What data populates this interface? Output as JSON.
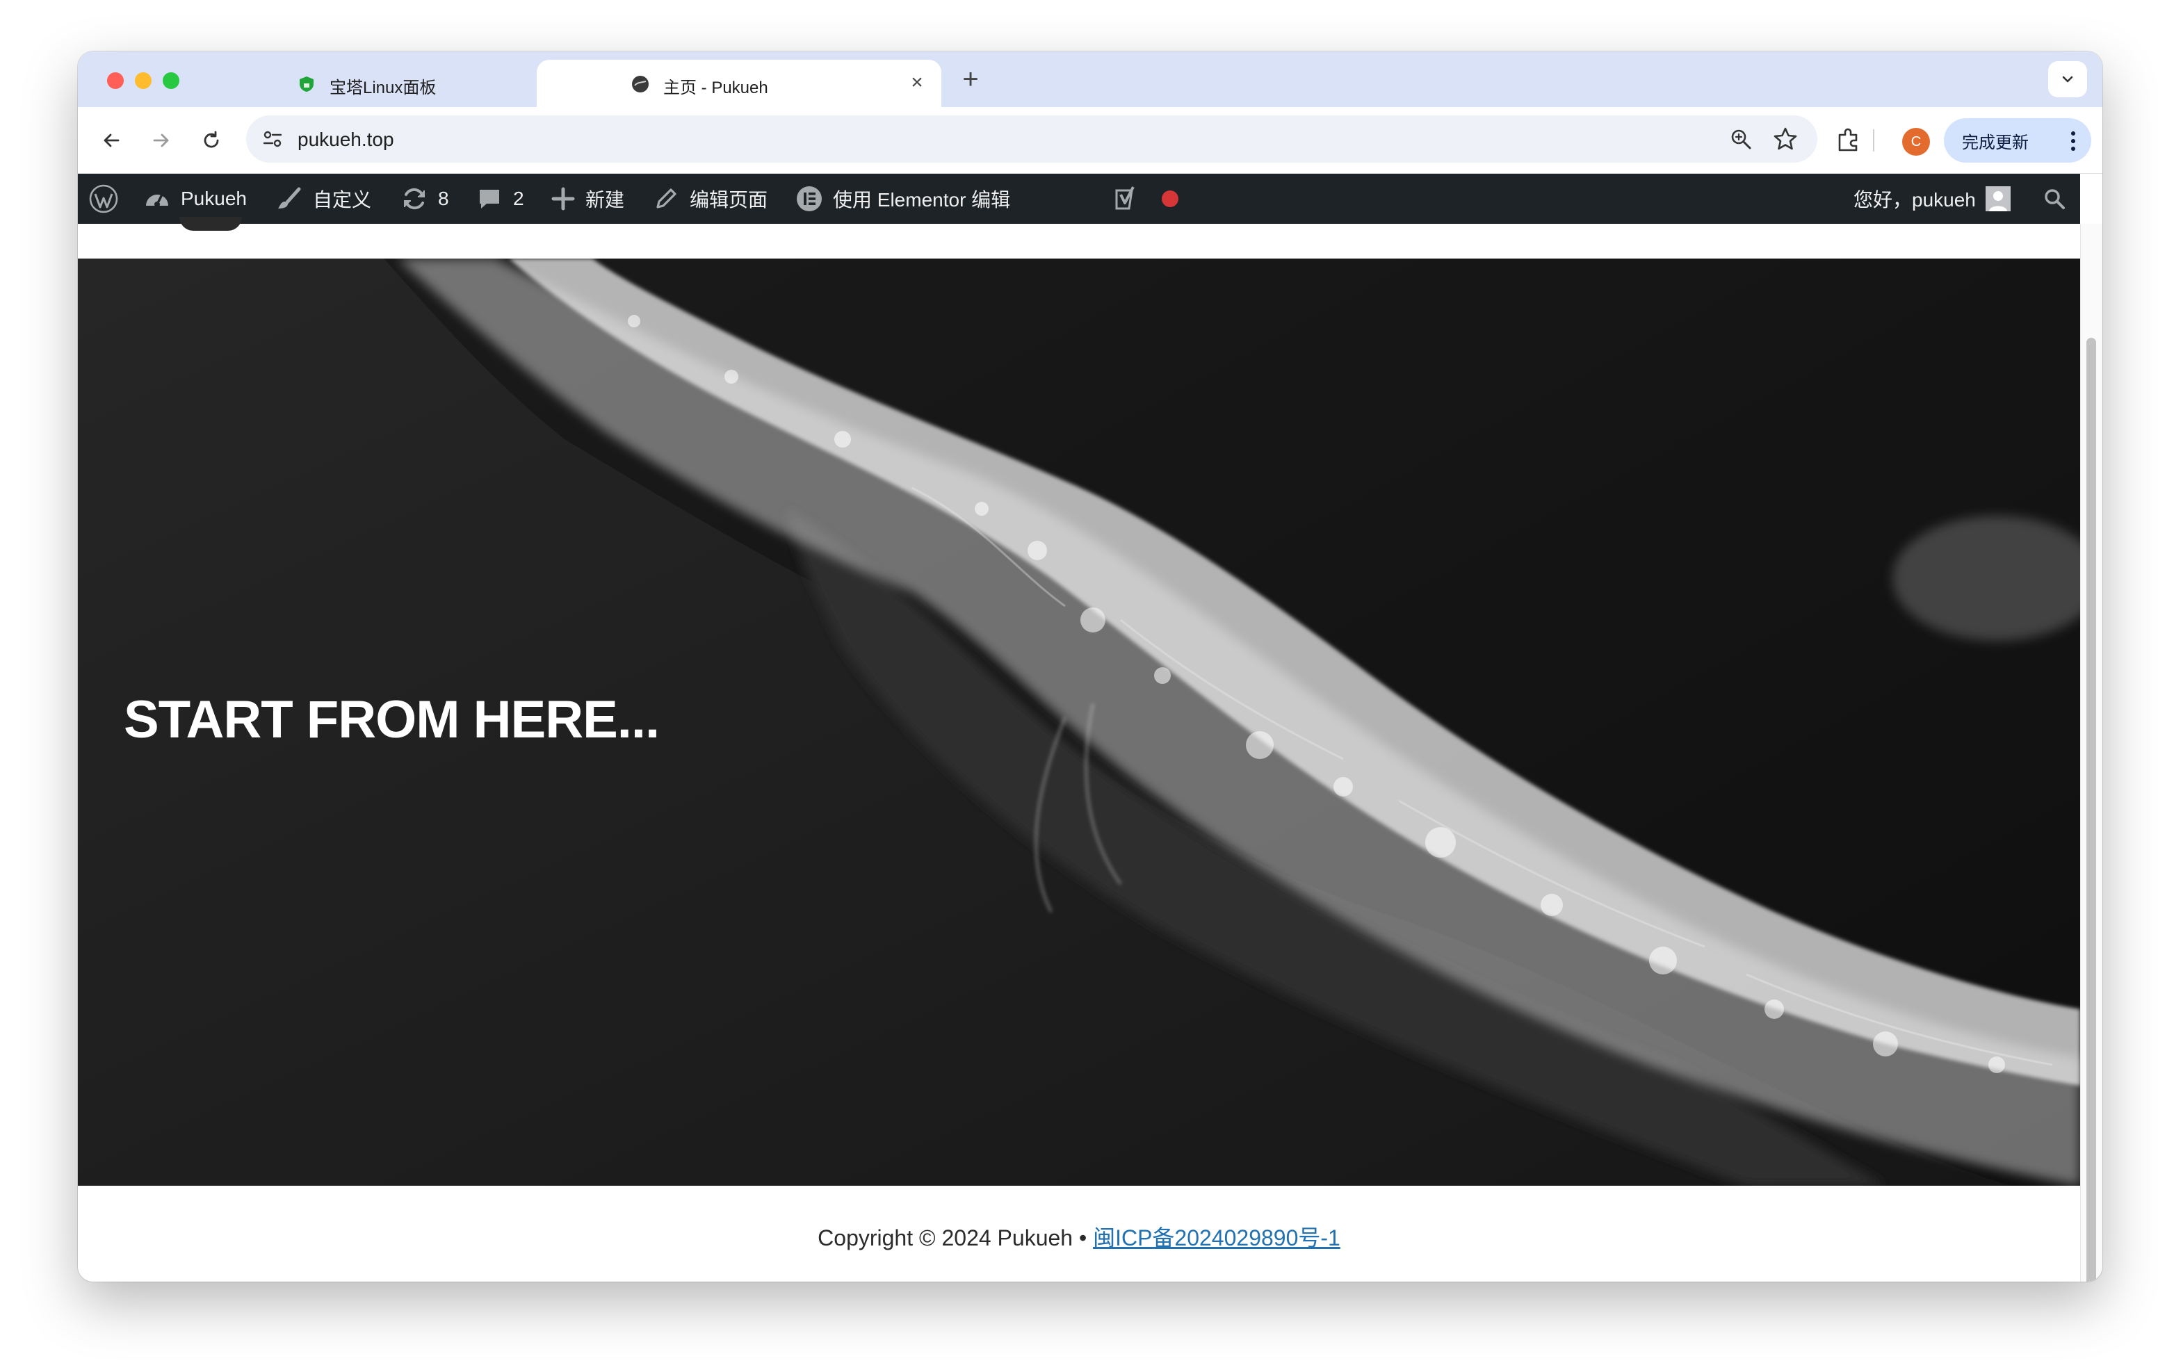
{
  "browser": {
    "tabs": [
      {
        "title": "宝塔Linux面板",
        "active": false,
        "favicon": "baota-shield-icon"
      },
      {
        "title": "主页 - Pukueh",
        "active": true,
        "favicon": "site-avatar-icon"
      }
    ],
    "address": "pukueh.top",
    "profile_initial": "C",
    "update_label": "完成更新",
    "colors": {
      "tabstrip": "#d9e2f6",
      "update_button": "#d3e3fd",
      "profile": "#e46b2e"
    }
  },
  "adminbar": {
    "site_name": "Pukueh",
    "customize": "自定义",
    "updates_count": "8",
    "comments_count": "2",
    "new": "新建",
    "edit_page": "编辑页面",
    "elementor": "使用 Elementor 编辑",
    "greeting": "您好，pukueh",
    "colors": {
      "background": "#1d2327",
      "status_dot": "#d63638"
    }
  },
  "hero": {
    "title": "START FROM HERE..."
  },
  "footer": {
    "copyright": "Copyright © 2024 Pukueh • ",
    "icp_link": "闽ICP备2024029890号-1"
  }
}
